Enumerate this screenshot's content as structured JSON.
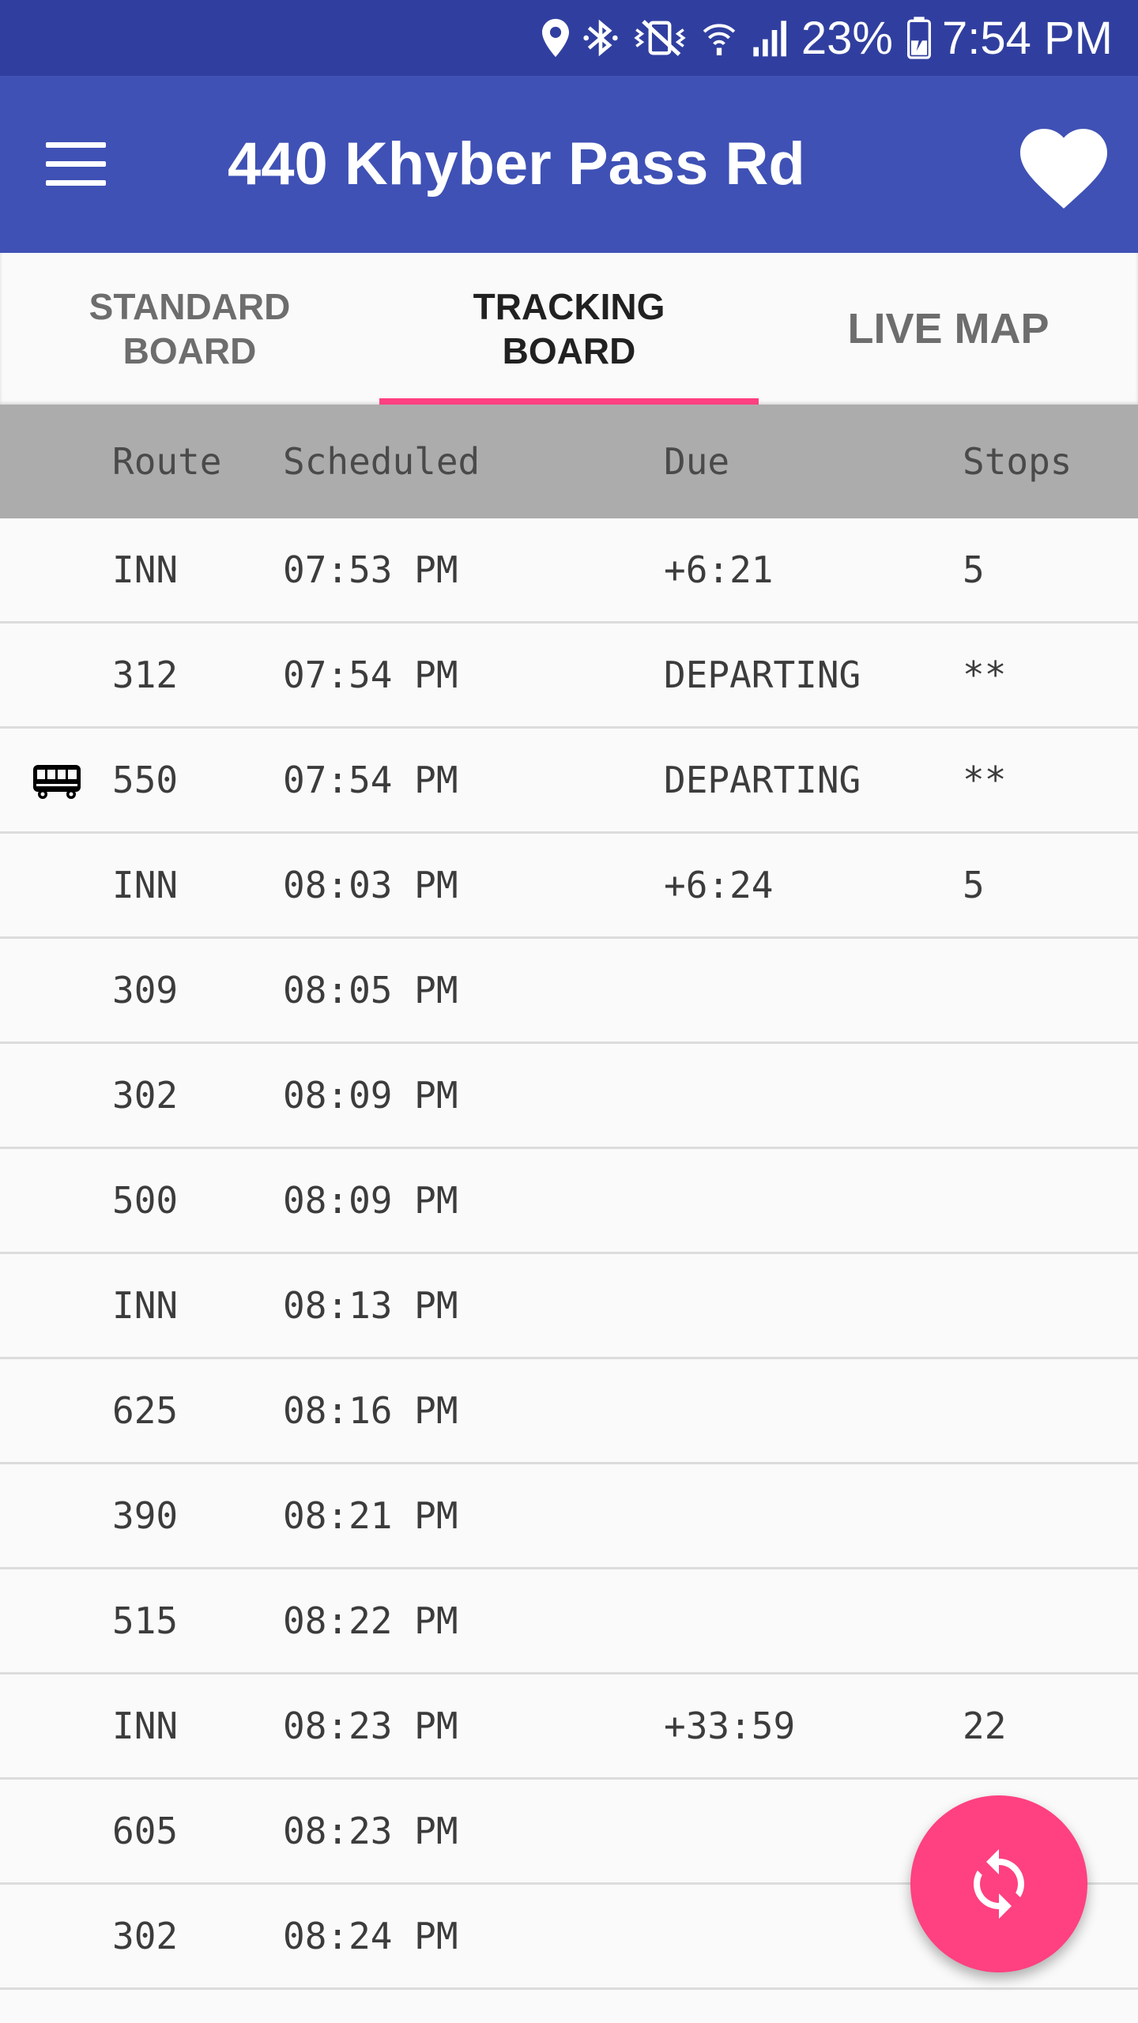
{
  "status_bar": {
    "battery": "23%",
    "time": "7:54 PM",
    "icons": [
      "location-icon",
      "bluetooth-icon",
      "vibrate-mute-icon",
      "wifi-icon",
      "signal-icon",
      "battery-charging-icon"
    ]
  },
  "app_bar": {
    "title": "440 Khyber Pass Rd",
    "menu_icon": "menu-icon",
    "favorite_icon": "heart-icon"
  },
  "tabs": [
    {
      "label": "STANDARD\nBOARD",
      "active": false
    },
    {
      "label": "TRACKING\nBOARD",
      "active": true
    },
    {
      "label": "LIVE MAP",
      "active": false
    }
  ],
  "table": {
    "headers": {
      "route": "Route",
      "scheduled": "Scheduled",
      "due": "Due",
      "stops": "Stops"
    },
    "rows": [
      {
        "route": "INN",
        "scheduled": "07:53 PM",
        "due": "+6:21",
        "stops": "5",
        "bus_icon": false
      },
      {
        "route": "312",
        "scheduled": "07:54 PM",
        "due": "DEPARTING",
        "stops": "**",
        "bus_icon": false
      },
      {
        "route": "550",
        "scheduled": "07:54 PM",
        "due": "DEPARTING",
        "stops": "**",
        "bus_icon": true
      },
      {
        "route": "INN",
        "scheduled": "08:03 PM",
        "due": "+6:24",
        "stops": "5",
        "bus_icon": false
      },
      {
        "route": "309",
        "scheduled": "08:05 PM",
        "due": "",
        "stops": "",
        "bus_icon": false
      },
      {
        "route": "302",
        "scheduled": "08:09 PM",
        "due": "",
        "stops": "",
        "bus_icon": false
      },
      {
        "route": "500",
        "scheduled": "08:09 PM",
        "due": "",
        "stops": "",
        "bus_icon": false
      },
      {
        "route": "INN",
        "scheduled": "08:13 PM",
        "due": "",
        "stops": "",
        "bus_icon": false
      },
      {
        "route": "625",
        "scheduled": "08:16 PM",
        "due": "",
        "stops": "",
        "bus_icon": false
      },
      {
        "route": "390",
        "scheduled": "08:21 PM",
        "due": "",
        "stops": "",
        "bus_icon": false
      },
      {
        "route": "515",
        "scheduled": "08:22 PM",
        "due": "",
        "stops": "",
        "bus_icon": false
      },
      {
        "route": "INN",
        "scheduled": "08:23 PM",
        "due": "+33:59",
        "stops": "22",
        "bus_icon": false
      },
      {
        "route": "605",
        "scheduled": "08:23 PM",
        "due": "",
        "stops": "",
        "bus_icon": false
      },
      {
        "route": "302",
        "scheduled": "08:24 PM",
        "due": "",
        "stops": "",
        "bus_icon": false
      }
    ]
  },
  "fab": {
    "icon": "refresh-icon"
  },
  "colors": {
    "status_bar": "#303f9f",
    "app_bar": "#3f51b5",
    "accent": "#ff4081",
    "header_bg": "#acacac"
  }
}
